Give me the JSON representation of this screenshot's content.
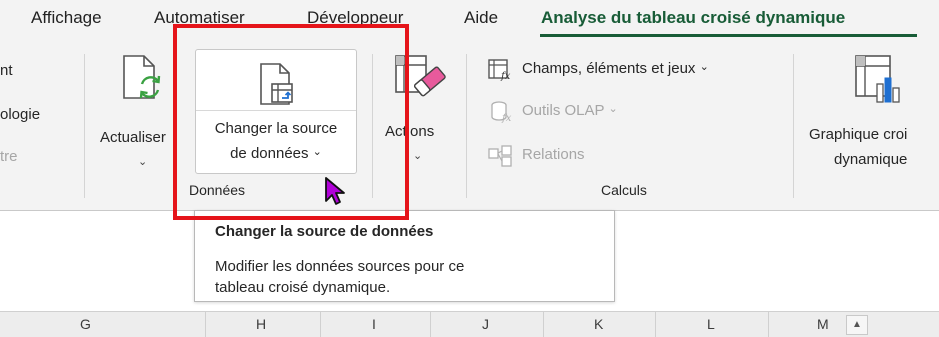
{
  "tabs": {
    "affichage": "Affichage",
    "automatiser": "Automatiser",
    "developpeur": "Développeur",
    "aide": "Aide",
    "analyse": "Analyse du tableau croisé dynamique"
  },
  "left_clipped": {
    "line1": "nt",
    "line2": "ologie",
    "line3": "tre"
  },
  "donnees_group": {
    "actualiser_label": "Actualiser",
    "changer_line1": "Changer la source",
    "changer_line2": "de données",
    "group_label": "Données"
  },
  "actions": {
    "label": "Actions"
  },
  "calculs_group": {
    "champs": "Champs, éléments et jeux",
    "olap": "Outils OLAP",
    "relations": "Relations",
    "group_label": "Calculs"
  },
  "graphique": {
    "line1": "Graphique croi",
    "line2": "dynamique"
  },
  "tooltip": {
    "title": "Changer la source de données",
    "body_line1": "Modifier les données sources pour ce",
    "body_line2": "tableau croisé dynamique."
  },
  "columns": [
    "G",
    "H",
    "I",
    "J",
    "K",
    "L",
    "M"
  ],
  "colors": {
    "accent_green": "#185c37",
    "highlight_red": "#e5141a",
    "cursor_purple": "#b000d8"
  }
}
